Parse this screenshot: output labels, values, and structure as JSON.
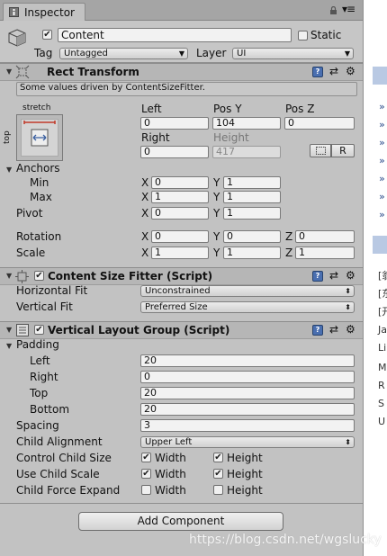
{
  "tab": {
    "label": "Inspector"
  },
  "gameobject": {
    "active": true,
    "name": "Content",
    "static_label": "Static",
    "static": false,
    "tag_label": "Tag",
    "tag_value": "Untagged",
    "layer_label": "Layer",
    "layer_value": "UI"
  },
  "rect_transform": {
    "title": "Rect Transform",
    "driven_notice": "Some values driven by ContentSizeFitter.",
    "anchor_preset_h": "stretch",
    "anchor_preset_v": "top",
    "labels": {
      "left": "Left",
      "pos_y": "Pos Y",
      "pos_z": "Pos Z",
      "right": "Right",
      "height": "Height"
    },
    "values": {
      "left": "0",
      "pos_y": "104",
      "pos_z": "0",
      "right": "0",
      "height": "417"
    },
    "raw_button": "R",
    "anchors_label": "Anchors",
    "min_label": "Min",
    "max_label": "Max",
    "anchors_min": {
      "x": "0",
      "y": "1"
    },
    "anchors_max": {
      "x": "1",
      "y": "1"
    },
    "pivot_label": "Pivot",
    "pivot": {
      "x": "0",
      "y": "1"
    },
    "rotation_label": "Rotation",
    "rotation": {
      "x": "0",
      "y": "0",
      "z": "0"
    },
    "scale_label": "Scale",
    "scale": {
      "x": "1",
      "y": "1",
      "z": "1"
    },
    "axis": {
      "x": "X",
      "y": "Y",
      "z": "Z"
    }
  },
  "content_size_fitter": {
    "title": "Content Size Fitter (Script)",
    "enabled": true,
    "horizontal_fit_label": "Horizontal Fit",
    "horizontal_fit": "Unconstrained",
    "vertical_fit_label": "Vertical Fit",
    "vertical_fit": "Preferred Size"
  },
  "vertical_layout_group": {
    "title": "Vertical Layout Group (Script)",
    "enabled": true,
    "padding_label": "Padding",
    "padding": [
      {
        "label": "Left",
        "value": "20"
      },
      {
        "label": "Right",
        "value": "0"
      },
      {
        "label": "Top",
        "value": "20"
      },
      {
        "label": "Bottom",
        "value": "20"
      }
    ],
    "spacing_label": "Spacing",
    "spacing": "3",
    "child_alignment_label": "Child Alignment",
    "child_alignment": "Upper Left",
    "child_control_size_label": "Control Child Size",
    "use_child_scale_label": "Use Child Scale",
    "child_force_expand_label": "Child Force Expand",
    "width_label": "Width",
    "height_label": "Height",
    "control_child_size": {
      "width": true,
      "height": true
    },
    "use_child_scale": {
      "width": true,
      "height": true
    },
    "child_force_expand": {
      "width": false,
      "height": false
    }
  },
  "add_component": "Add Component",
  "right_panel": {
    "bullets": [
      "»",
      "»",
      "»",
      "»",
      "»",
      "»",
      "»"
    ],
    "texts": [
      "[翁",
      "[东",
      "[开",
      "Ja",
      "Li",
      "M",
      "R",
      "S",
      "U"
    ]
  },
  "watermark": "https://blog.csdn.net/wgslucky",
  "colors": {
    "accent": "#4a6fb0",
    "panel": "#c2c2c2",
    "header": "#b6b6b6"
  }
}
